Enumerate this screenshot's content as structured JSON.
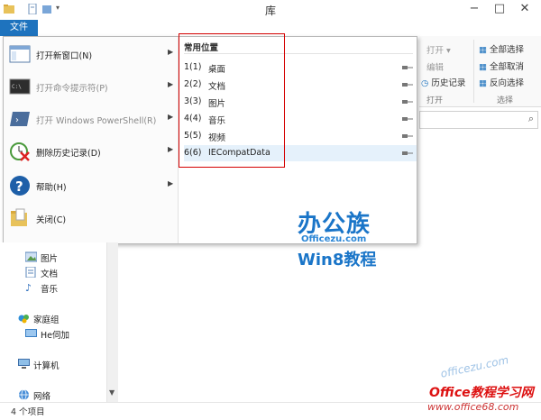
{
  "window": {
    "title": "库"
  },
  "ribbon": {
    "file_tab": "文件",
    "open": "打开",
    "edit": "编辑",
    "history": "历史记录",
    "open_group": "打开",
    "select_all": "全部选择",
    "select_none": "全部取消",
    "invert": "反向选择",
    "select_group": "选择"
  },
  "file_menu": {
    "items": [
      {
        "label": "打开新窗口(N)",
        "disabled": false,
        "submenu": true,
        "icon": "new-window-icon"
      },
      {
        "label": "打开命令提示符(P)",
        "disabled": true,
        "submenu": true,
        "icon": "command-prompt-icon"
      },
      {
        "label": "打开 Windows PowerShell(R)",
        "disabled": true,
        "submenu": true,
        "icon": "powershell-icon"
      },
      {
        "label": "删除历史记录(D)",
        "disabled": false,
        "submenu": true,
        "icon": "delete-history-icon"
      },
      {
        "label": "帮助(H)",
        "disabled": false,
        "submenu": true,
        "icon": "help-icon"
      },
      {
        "label": "关闭(C)",
        "disabled": false,
        "submenu": false,
        "icon": "close-folder-icon"
      }
    ],
    "places_header": "常用位置",
    "places": [
      {
        "num": "1(1)",
        "name": "桌面"
      },
      {
        "num": "2(2)",
        "name": "文档"
      },
      {
        "num": "3(3)",
        "name": "图片"
      },
      {
        "num": "4(4)",
        "name": "音乐"
      },
      {
        "num": "5(5)",
        "name": "视频"
      },
      {
        "num": "6(6)",
        "name": "IECompatData"
      }
    ]
  },
  "nav_pane": {
    "items": [
      {
        "label": "图片",
        "icon": "pictures-icon"
      },
      {
        "label": "文档",
        "icon": "documents-icon"
      },
      {
        "label": "音乐",
        "icon": "music-icon"
      },
      {
        "label": "家庭组",
        "icon": "homegroup-icon"
      },
      {
        "label": "He伺加",
        "icon": "user-icon"
      },
      {
        "label": "计算机",
        "icon": "computer-icon"
      },
      {
        "label": "网络",
        "icon": "network-icon"
      }
    ]
  },
  "status": {
    "text": "4 个项目"
  },
  "watermarks": {
    "brand": "办公族",
    "site": "Officezu.com",
    "course": "Win8教程",
    "logo2": "Office教程学习网",
    "url2": "www.office68.com",
    "faint": "officezu.com"
  },
  "colors": {
    "accent": "#1e73be",
    "highlight_box": "#d40000",
    "selection": "#e5f1fb"
  }
}
